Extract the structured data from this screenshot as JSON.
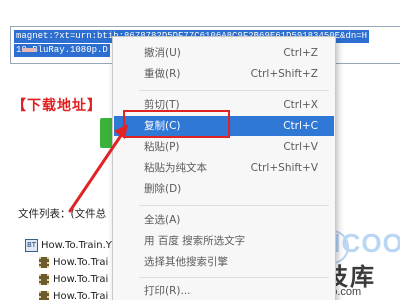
{
  "magnet": {
    "line1": "magnet:?xt=urn:btih:8678782D5DF77C6106A8C9F2B69E61D59183450E&dn=H",
    "line2": "10.BluRay.1080p.D"
  },
  "page": {
    "download_heading": "【下载地址】",
    "file_list_label": "文件列表：(文件总"
  },
  "tree": {
    "root_label": "How.To.Train.Y",
    "root_icon": "BT",
    "children": [
      "How.To.Trai",
      "How.To.Trai",
      "How.To.Trai"
    ]
  },
  "context_menu": {
    "items": [
      {
        "label": "撤消(U)",
        "shortcut": "Ctrl+Z"
      },
      {
        "label": "重做(R)",
        "shortcut": "Ctrl+Shift+Z"
      },
      {
        "label": "剪切(T)",
        "shortcut": "Ctrl+X"
      },
      {
        "label": "复制(C)",
        "shortcut": "Ctrl+C"
      },
      {
        "label": "粘贴(P)",
        "shortcut": "Ctrl+V"
      },
      {
        "label": "粘贴为纯文本",
        "shortcut": "Ctrl+Shift+V"
      },
      {
        "label": "删除(D)",
        "shortcut": ""
      },
      {
        "label": "全选(A)",
        "shortcut": ""
      },
      {
        "label": "用 百度 搜索所选文字",
        "shortcut": ""
      },
      {
        "label": "选择其他搜索引擎",
        "shortcut": ""
      },
      {
        "label": "打印(R)...",
        "shortcut": ""
      }
    ],
    "active_item": "复制(C)"
  },
  "watermark": {
    "brand": "KHCOO",
    "name_cn": "科技库",
    "url": "khcoo.com"
  },
  "colors": {
    "accent_blue": "#2f78d6",
    "highlight_red": "#e02424"
  }
}
